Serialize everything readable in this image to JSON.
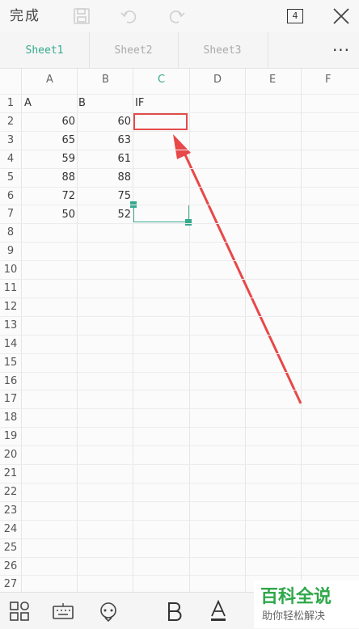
{
  "toolbar": {
    "done_label": "完成",
    "sheet_count": "4"
  },
  "tabs": [
    "Sheet1",
    "Sheet2",
    "Sheet3"
  ],
  "more_label": "···",
  "grid": {
    "columns": [
      "A",
      "B",
      "C",
      "D",
      "E",
      "F"
    ],
    "active_column": "C",
    "rows": [
      "1",
      "2",
      "3",
      "4",
      "5",
      "6",
      "7",
      "8",
      "9",
      "10",
      "11",
      "12",
      "13",
      "14",
      "15",
      "16",
      "17",
      "18",
      "19",
      "20",
      "21",
      "22",
      "23",
      "24",
      "25",
      "26",
      "27"
    ],
    "cells": {
      "header_a": "A",
      "header_b": "B",
      "header_c": "IF",
      "col_a_values": [
        "60",
        "65",
        "59",
        "88",
        "72",
        "50"
      ],
      "col_b_values": [
        "60",
        "63",
        "61",
        "88",
        "75",
        "52"
      ]
    }
  },
  "watermark": {
    "title": "百科全说",
    "subtitle": "助你轻松解决"
  },
  "colors": {
    "accent": "#37a98e",
    "highlight_red": "#e14b4b",
    "watermark_green": "#2fa84a"
  }
}
